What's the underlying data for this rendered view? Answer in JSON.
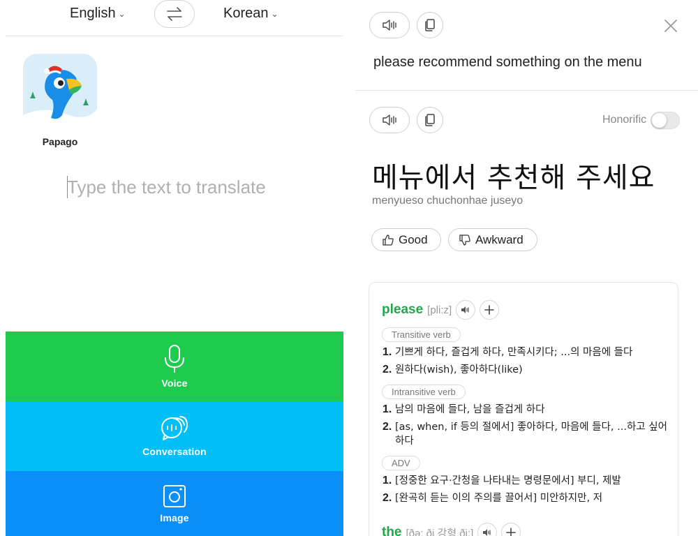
{
  "left": {
    "source_lang": "English",
    "target_lang": "Korean",
    "app_name": "Papago",
    "input": {
      "placeholder": "Type the text to translate",
      "value": ""
    },
    "modes": [
      {
        "label": "Voice",
        "icon": "microphone-icon",
        "color": "#1ecb4f"
      },
      {
        "label": "Conversation",
        "icon": "conversation-icon",
        "color": "#02bff7"
      },
      {
        "label": "Image",
        "icon": "camera-icon",
        "color": "#0a8ef8"
      }
    ]
  },
  "right": {
    "source_text": "please recommend something on the menu",
    "honorific_label": "Honorific",
    "honorific_on": false,
    "translation": "메뉴에서 추천해 주세요",
    "romanization": "menyueso chuchonhae juseyo",
    "feedback": {
      "good": "Good",
      "awkward": "Awkward"
    },
    "dictionary": {
      "entries": [
        {
          "word": "please",
          "phonetic": "[pli:z]",
          "senses": [
            {
              "pos": "Transitive verb",
              "defs": [
                {
                  "num": "1.",
                  "text": "기쁘게 하다, 즐겁게 하다, 만족시키다; ...의 마음에 들다"
                },
                {
                  "num": "2.",
                  "text": "원하다(wish), 좋아하다(like)"
                }
              ]
            },
            {
              "pos": "Intransitive verb",
              "defs": [
                {
                  "num": "1.",
                  "text": "남의 마음에 들다, 남을 즐겁게 하다"
                },
                {
                  "num": "2.",
                  "text": "[as, when, if 등의 절에서] 좋아하다, 마음에 들다, ...하고 싶어하다"
                }
              ]
            },
            {
              "pos": "ADV",
              "defs": [
                {
                  "num": "1.",
                  "text": "[정중한 요구·간청을 나타내는 명령문에서] 부디, 제발"
                },
                {
                  "num": "2.",
                  "text": "[완곡히 듣는 이의 주의를 끌어서] 미안하지만, 저"
                }
              ]
            }
          ]
        },
        {
          "word": "the",
          "phonetic": "[ðə; ði 강형 ði:]"
        }
      ]
    }
  }
}
